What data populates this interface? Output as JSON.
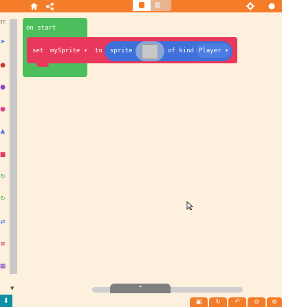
{
  "toolbar": {
    "home_icon": "home-icon",
    "share_icon": "share-icon",
    "settings_icon": "gear-icon",
    "mode_switch": {
      "active": "blocks",
      "accent": "#f57d2a"
    }
  },
  "toolbox": {
    "label": "IC",
    "categories": [
      {
        "icon": "sprites-icon",
        "color": "#4b7bec"
      },
      {
        "icon": "controller-icon",
        "color": "#d4382b"
      },
      {
        "icon": "game-icon",
        "color": "#8f3fd6"
      },
      {
        "icon": "music-icon",
        "color": "#e63c8c"
      },
      {
        "icon": "scene-icon",
        "color": "#4b7bec"
      },
      {
        "icon": "info-icon",
        "color": "#e8385b"
      },
      {
        "icon": "loops-icon",
        "color": "#3fb34f"
      },
      {
        "icon": "logic-icon",
        "color": "#3fb34f"
      },
      {
        "icon": "variables-icon",
        "color": "#4b7bec"
      },
      {
        "icon": "math-icon",
        "color": "#c8243e"
      },
      {
        "icon": "images-icon",
        "color": "#7a3fc6"
      }
    ],
    "download_icon": "download-icon"
  },
  "workspace": {
    "on_start": "on start",
    "set": "set",
    "variable": "mySprite ▾",
    "to": "to",
    "sprite": "sprite",
    "of_kind": "of kind",
    "kind_value": "Player ▾"
  },
  "bottom_tools": {
    "collapse_icon": "chevron-up-icon",
    "save_icon": "save-icon",
    "redo_icon": "redo-icon",
    "undo_icon": "undo-icon",
    "zoom_out_icon": "zoom-out-icon",
    "zoom_in_icon": "zoom-in-icon"
  }
}
